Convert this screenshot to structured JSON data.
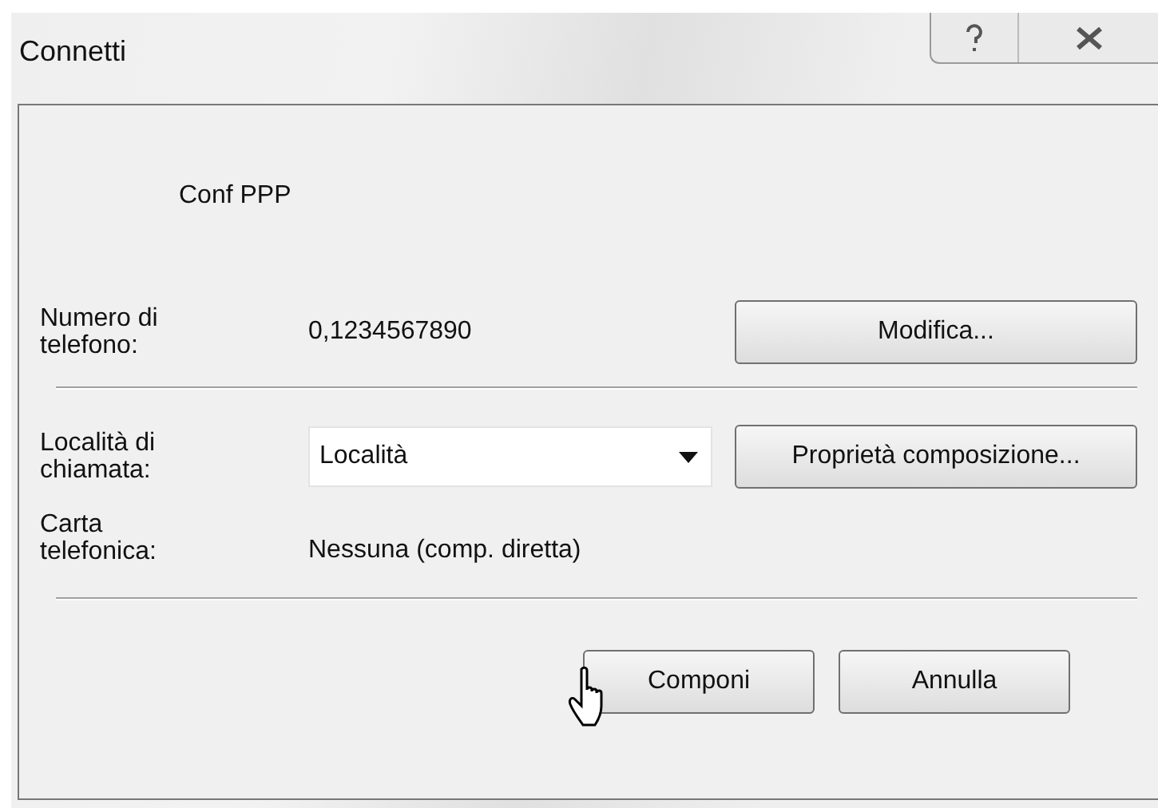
{
  "window": {
    "title": "Connetti",
    "controls": [
      {
        "kind": "help"
      },
      {
        "kind": "close"
      }
    ]
  },
  "connection_name": "Conf PPP",
  "phone": {
    "label": "Numero di telefono:",
    "value": "0,1234567890",
    "button": "Modifica..."
  },
  "location": {
    "label": "Località di chiamata:",
    "value": "Località",
    "button": "Proprietà composizione..."
  },
  "calling_card": {
    "label": "Carta telefonica:",
    "value": "Nessuna (comp. diretta)"
  },
  "buttons": [
    "Componi",
    "Annulla"
  ]
}
